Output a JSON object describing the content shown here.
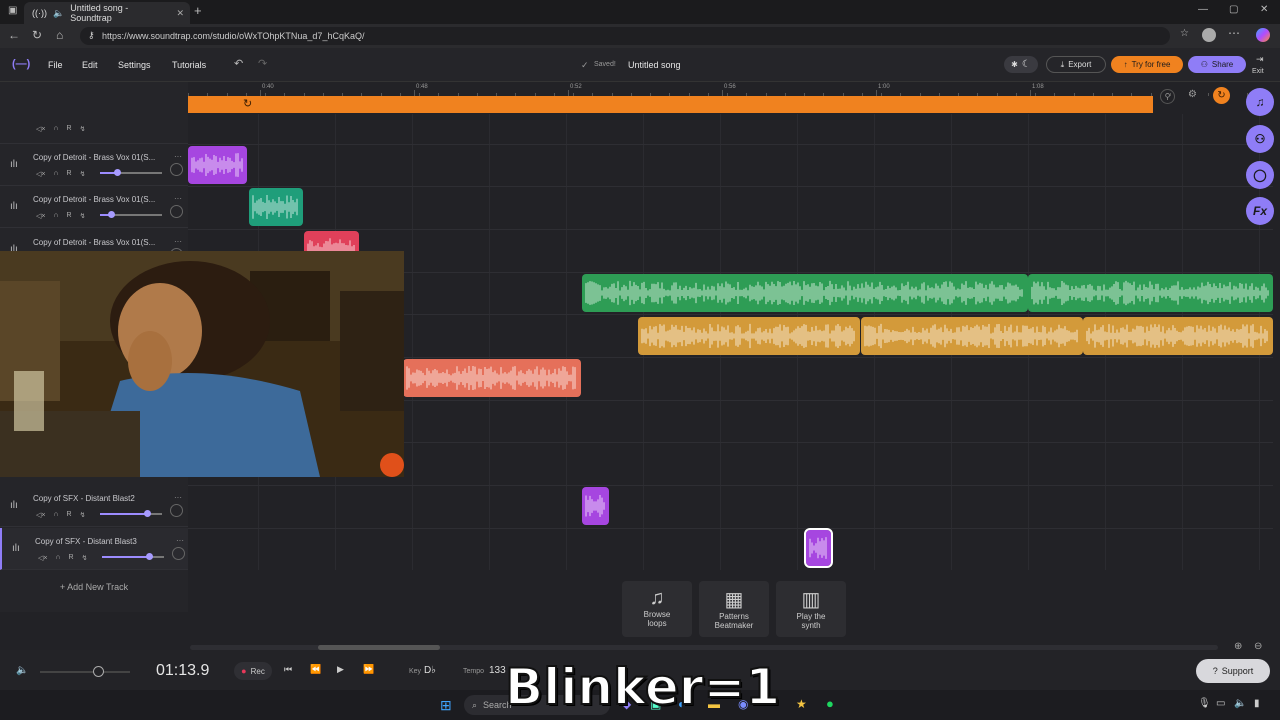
{
  "browser": {
    "tab_title": "Untitled song - Soundtrap",
    "url": "https://www.soundtrap.com/studio/oWxTOhpKTNua_d7_hCqKaQ/"
  },
  "app": {
    "menu": [
      "File",
      "Edit",
      "Settings",
      "Tutorials"
    ],
    "saved_label": "Saved!",
    "song_title": "Untitled song",
    "export_label": "Export",
    "try_label": "Try for free",
    "share_label": "Share",
    "exit_label": "Exit"
  },
  "ruler": {
    "labels": [
      "0:40",
      "0:48",
      "0:52",
      "0:56",
      "1:00",
      "1:08"
    ]
  },
  "tracks": [
    {
      "name": "Copy of Detroit - Brass Vox 01(S...",
      "volume": 0.28
    },
    {
      "name": "Copy of Detroit - Brass Vox 01(S...",
      "volume": 0.18
    },
    {
      "name": "Copy of Detroit - Brass Vox 01(S...",
      "volume": 0.5
    },
    {
      "name": "Copy of SFX - Distant Blast2",
      "volume": 0.75
    },
    {
      "name": "Copy of SFX - Distant Blast3",
      "volume": 0.75
    }
  ],
  "track_ctl": [
    "R"
  ],
  "add_track_label": "+ Add New Track",
  "tools": [
    {
      "line1": "Browse",
      "line2": "loops"
    },
    {
      "line1": "Patterns",
      "line2": "Beatmaker"
    },
    {
      "line1": "Play the",
      "line2": "synth"
    }
  ],
  "transport": {
    "time": "01:13.9",
    "rec_label": "Rec",
    "key_label": "Key",
    "key_value": "D♭",
    "tempo_label": "Tempo",
    "tempo_value": "133",
    "support_label": "Support"
  },
  "taskbar": {
    "search_label": "Search"
  },
  "overlay_text": "Blinker=1",
  "colors": {
    "accent": "#8f7df7",
    "loop": "#f0821f",
    "clip_purple": "#a646e0",
    "clip_teal": "#1f9e7a",
    "clip_red": "#e0405a",
    "clip_green": "#2e9d55",
    "clip_gold": "#d39a3a",
    "clip_salmon": "#e5705a"
  }
}
